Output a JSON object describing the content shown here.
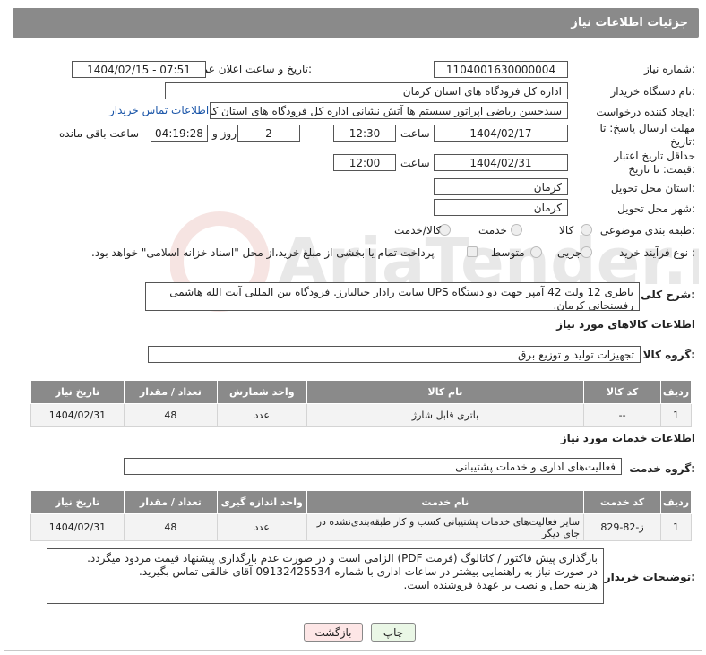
{
  "header": {
    "title": "جزئیات اطلاعات نیاز"
  },
  "fields": {
    "need_number_label": "شماره نیاز:",
    "need_number": "1104001630000004",
    "announce_label": "تاریخ و ساعت اعلان عمومی:",
    "announce_value": "1404/02/15 - 07:51",
    "buyer_org_label": "نام دستگاه خریدار:",
    "buyer_org": "اداره کل فرودگاه های استان کرمان",
    "creator_label": "ایجاد کننده درخواست:",
    "creator": "سیدحسن ریاضی اپراتور سیستم ها آتش نشانی اداره کل فرودگاه های استان کرمان",
    "contact_link": "اطلاعات تماس خریدار",
    "deadline_label": "مهلت ارسال پاسخ: تا تاریخ:",
    "deadline_date": "1404/02/17",
    "time_label": "ساعت",
    "deadline_time": "12:30",
    "days_value": "2",
    "days_label": "روز و",
    "remaining_time": "04:19:28",
    "remaining_label": "ساعت باقی مانده",
    "price_validity_label": "حداقل تاریخ اعتبار قیمت: تا تاریخ:",
    "price_date": "1404/02/31",
    "price_time": "12:00",
    "province_label": "استان محل تحویل:",
    "province": "کرمان",
    "city_label": "شهر محل تحویل:",
    "city": "کرمان",
    "category_label": "طبقه بندی موضوعی:",
    "category_options": [
      "کالا",
      "خدمت",
      "کالا/خدمت"
    ],
    "process_label": "نوع فرآیند خرید :",
    "process_options": [
      "جزیی",
      "متوسط"
    ],
    "payment_note": "پرداخت تمام یا بخشی از مبلغ خرید،از محل \"اسناد خزانه اسلامی\" خواهد بود."
  },
  "description": {
    "label": "شرح کلی نیاز:",
    "text": "باطری 12 ولت 42 آمپر جهت دو دستگاه  UPS سایت رادار جبالبارز. فرودگاه بین المللی آیت الله هاشمی رفسنجانی کرمان."
  },
  "goods": {
    "section_title": "اطلاعات کالاهای مورد نیاز",
    "group_label": "گروه کالا:",
    "group_value": "تجهیزات تولید و توزیع برق",
    "columns": [
      "ردیف",
      "کد کالا",
      "نام کالا",
      "واحد شمارش",
      "تعداد / مقدار",
      "تاریخ نیاز"
    ],
    "rows": [
      {
        "row": "1",
        "code": "--",
        "name": "باتری قابل شارژ",
        "unit": "عدد",
        "qty": "48",
        "date": "1404/02/31"
      }
    ]
  },
  "services": {
    "section_title": "اطلاعات خدمات مورد نیاز",
    "group_label": "گروه خدمت:",
    "group_value": "فعالیت‌های اداری و خدمات پشتیبانی",
    "columns": [
      "ردیف",
      "کد خدمت",
      "نام خدمت",
      "واحد اندازه گیری",
      "تعداد / مقدار",
      "تاریخ نیاز"
    ],
    "rows": [
      {
        "row": "1",
        "code": "ز-82-829",
        "name": "سایر فعالیت‌های خدمات پشتیبانی کسب و کار طبقه‌بندی‌نشده در جای دیگر",
        "unit": "عدد",
        "qty": "48",
        "date": "1404/02/31"
      }
    ]
  },
  "buyer_notes": {
    "label": "توضیحات خریدار:",
    "lines": [
      "بارگذاری پیش فاکتور / کاتالوگ (فرمت PDF) الزامی است و در صورت عدم بارگذاری پیشنهاد قیمت مردود میگردد.",
      "در صورت نیاز به راهنمایی بیشتر در ساعات اداری با شماره 09132425534 آقای خالقی تماس بگیرید.",
      "هزینه حمل و نصب بر عهدهٔ فروشنده است."
    ]
  },
  "buttons": {
    "print": "چاپ",
    "back": "بازگشت"
  },
  "watermark": {
    "text": "AriaTender.neT"
  },
  "colors": {
    "header_bg": "#8a8a8a",
    "link": "#1a55a8",
    "back_button_bg": "#fde6e6",
    "print_button_bg": "#eaf7e6"
  }
}
